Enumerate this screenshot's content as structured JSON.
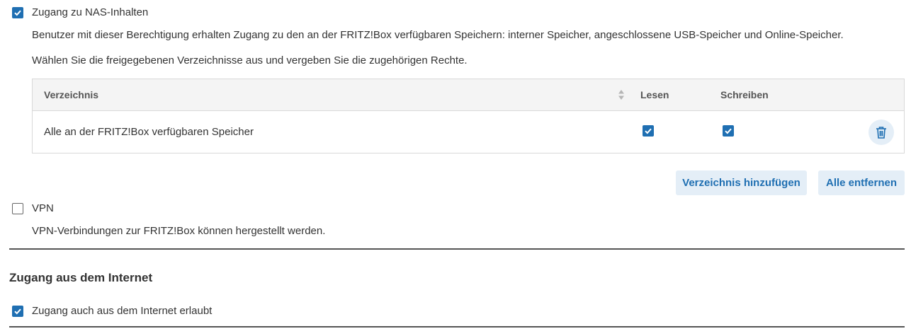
{
  "nas": {
    "checked": true,
    "label": "Zugang zu NAS-Inhalten",
    "description": "Benutzer mit dieser Berechtigung erhalten Zugang zu den an der FRITZ!Box verfügbaren Speichern: interner Speicher, angeschlossene USB-Speicher und Online-Speicher.",
    "hint": "Wählen Sie die freigegebenen Verzeichnisse aus und vergeben Sie die zugehörigen Rechte.",
    "table": {
      "columns": [
        "Verzeichnis",
        "Lesen",
        "Schreiben"
      ],
      "rows": [
        {
          "directory": "Alle an der FRITZ!Box verfügbaren Speicher",
          "read": true,
          "write": true
        }
      ]
    },
    "add_button": "Verzeichnis hinzufügen",
    "remove_all_button": "Alle entfernen"
  },
  "vpn": {
    "checked": false,
    "label": "VPN",
    "description": "VPN-Verbindungen zur FRITZ!Box können hergestellt werden."
  },
  "internet": {
    "title": "Zugang aus dem Internet",
    "checked": true,
    "label": "Zugang auch aus dem Internet erlaubt"
  },
  "icons": {
    "checkmark": "checkmark-icon",
    "sort": "sort-icon",
    "trash": "trash-icon"
  },
  "colors": {
    "accent": "#1f6fb2",
    "button_bg": "#e4eef7"
  }
}
